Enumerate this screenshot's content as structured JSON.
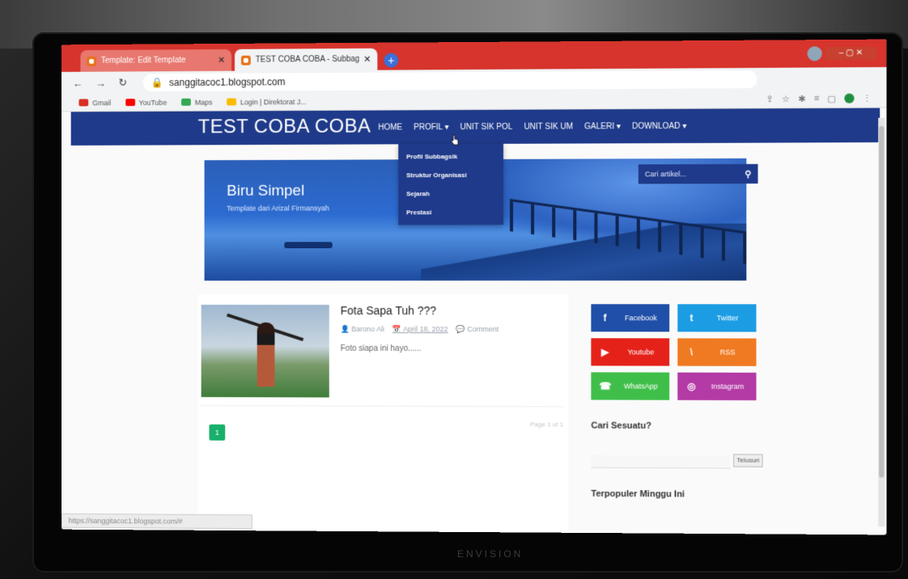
{
  "browser": {
    "tabs": [
      {
        "title": "Template: Edit Template"
      },
      {
        "title": "TEST COBA COBA - Subbagsik Yu"
      }
    ],
    "new_tab": "+",
    "url": "sanggitacoc1.blogspot.com",
    "bookmarks": [
      {
        "label": "Gmail",
        "color": "#d93025"
      },
      {
        "label": "YouTube",
        "color": "#ff0000"
      },
      {
        "label": "Maps",
        "color": "#34a853"
      },
      {
        "label": "Login | Direktorat J...",
        "color": "#fbbc04"
      }
    ],
    "status_url": "https://sanggitacoc1.blogspot.com/#",
    "back_icon": "back-arrow-icon",
    "forward_icon": "forward-arrow-icon",
    "reload_icon": "reload-icon"
  },
  "site": {
    "title": "TEST COBA COBA",
    "menu": [
      "HOME",
      "PROFIL ▾",
      "UNIT SIK POL",
      "UNIT SIK UM",
      "GALERI ▾",
      "DOWNLOAD ▾"
    ],
    "profil_dropdown": [
      "Profil Subbagsik",
      "Struktur Organisasi",
      "Sejarah",
      "Prestasi"
    ],
    "hero": {
      "title": "Biru Simpel",
      "subtitle": "Template dari Arizal Firmansyah"
    },
    "search_placeholder": "Cari artikel...",
    "search_icon": "magnifier-icon"
  },
  "post": {
    "title": "Fota Sapa Tuh ???",
    "author": "Barono Ali",
    "date": "April 18, 2022",
    "comment": "Comment",
    "snippet": "Foto siapa ini hayo......"
  },
  "pagination": {
    "current": "1",
    "info": "Page 1 of 1"
  },
  "sidebar": {
    "social": [
      {
        "label": "Facebook",
        "icon": "f",
        "color": "#1f4fa8"
      },
      {
        "label": "Twitter",
        "icon": "t",
        "color": "#1c9ce3"
      },
      {
        "label": "Youtube",
        "icon": "▶",
        "color": "#e5221a"
      },
      {
        "label": "RSS",
        "icon": "\\",
        "color": "#f07a21"
      },
      {
        "label": "WhatsApp",
        "icon": "☎",
        "color": "#3fbf4a"
      },
      {
        "label": "Instagram",
        "icon": "◎",
        "color": "#b43aa6"
      }
    ],
    "search_heading": "Cari Sesuatu?",
    "search_button": "Telusuri",
    "popular_heading": "Terpopuler Minggu Ini"
  },
  "monitor_brand": "ENVISION"
}
